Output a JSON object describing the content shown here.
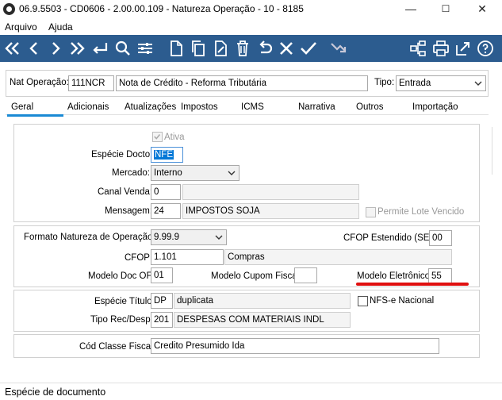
{
  "window": {
    "title": "06.9.5503 - CD0606 - 2.00.00.109 - Natureza Operação - 10 - 8185",
    "minimize_glyph": "—",
    "maximize_glyph": "☐",
    "close_glyph": "✕"
  },
  "menu": {
    "items": [
      "Arquivo",
      "Ajuda"
    ]
  },
  "toolbar": {
    "background": "#2c5c8f",
    "icons": [
      "first-record-icon",
      "previous-record-icon",
      "next-record-icon",
      "last-record-icon",
      "return-icon",
      "search-icon",
      "filter-settings-icon",
      "new-document-icon",
      "copy-icon",
      "edit-icon",
      "delete-icon",
      "undo-icon",
      "cancel-icon",
      "confirm-icon",
      "shortcut-icon",
      "org-chart-icon",
      "print-icon",
      "export-icon",
      "help-icon"
    ]
  },
  "header": {
    "nat_operacao_label": "Nat Operação:",
    "nat_operacao_code": "111NCR",
    "nat_operacao_desc": "Nota de Crédito - Reforma Tributária",
    "tipo_label": "Tipo:",
    "tipo_value": "Entrada"
  },
  "tabs": [
    {
      "label": "Geral",
      "active": true
    },
    {
      "label": "Adicionais"
    },
    {
      "label": "Atualizações"
    },
    {
      "label": "Impostos"
    },
    {
      "label": "ICMS"
    },
    {
      "label": "Narrativa"
    },
    {
      "label": "Outros"
    },
    {
      "label": "Importação"
    }
  ],
  "geral": {
    "ativa_label": "Ativa",
    "especie_docto_label": "Espécie Docto:",
    "especie_docto_value": "NFE",
    "mercado_label": "Mercado:",
    "mercado_value": "Interno",
    "canal_venda_label": "Canal Venda:",
    "canal_venda_code": "0",
    "canal_venda_desc": "",
    "mensagem_label": "Mensagem:",
    "mensagem_code": "24",
    "mensagem_desc": "IMPOSTOS SOJA",
    "permite_lote_label": "Permite Lote Vencido",
    "formato_label": "Formato Natureza de Operação:",
    "formato_value": "9.99.9",
    "cfop_estendido_label": "CFOP Estendido (SE):",
    "cfop_estendido_value": "00",
    "cfop_label": "CFOP:",
    "cfop_code": "1.101",
    "cfop_desc": "Compras",
    "modelo_doc_of_label": "Modelo Doc OF:",
    "modelo_doc_of_value": "01",
    "modelo_cupom_label": "Modelo Cupom Fiscal:",
    "modelo_cupom_value": "",
    "modelo_eletronico_label": "Modelo Eletrônico:",
    "modelo_eletronico_value": "55",
    "especie_titulo_label": "Espécie Título:",
    "especie_titulo_code": "DP",
    "especie_titulo_desc": "duplicata",
    "nfse_label": "NFS-e Nacional",
    "tipo_rec_desp_label": "Tipo Rec/Desp:",
    "tipo_rec_desp_code": "201",
    "tipo_rec_desp_desc": "DESPESAS COM MATERIAIS INDL",
    "cod_classe_fiscal_label": "Cód Classe Fiscal:",
    "cod_classe_fiscal_value": "Credito Presumido Ida"
  },
  "status": {
    "text": "Espécie de documento"
  },
  "colors": {
    "accent_tab": "#1a8ad4",
    "highlight_underline": "#e01010",
    "selected_text_bg": "#0078d7"
  }
}
